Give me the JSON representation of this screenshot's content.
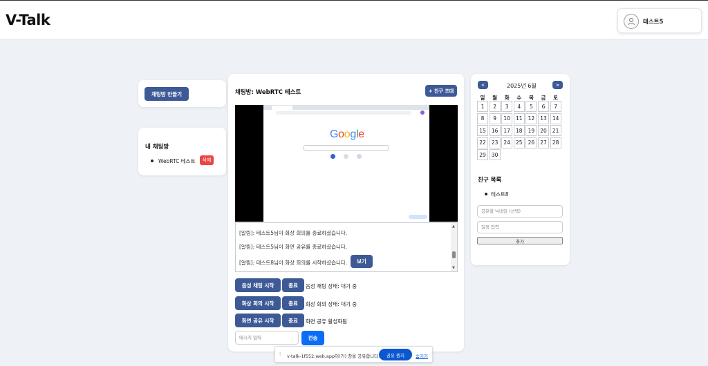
{
  "header": {
    "logo": "V-Talk",
    "user_name": "테스트5"
  },
  "sidebar": {
    "create_room_button": "채팅방 만들기",
    "my_rooms_title": "내 채팅방",
    "rooms": [
      {
        "name": "WebRTC 테스트",
        "delete_label": "삭제"
      }
    ]
  },
  "chat": {
    "title": "채팅방: WebRTC 테스트",
    "invite_button": "+ 친구 초대",
    "messages": [
      "[알림]: 테스트5님이 화상 회의를 종료하셨습니다.",
      "[알림]: 테스트5님이 화면 공유를 종료하셨습니다.",
      "[알림]: 테스트8님이 화상 회의를 시작하셨습니다."
    ],
    "view_button": "보기",
    "voice_start": "음성 채팅 시작",
    "voice_end": "종료",
    "voice_status": "음성 채팅 상태: 대기 중",
    "video_start": "화상 회의 시작",
    "video_end": "종료",
    "video_status": "화상 회의 상태: 대기 중",
    "screen_start": "화면 공유 시작",
    "screen_end": "종료",
    "screen_status": "화면 공유 활성화됨",
    "message_placeholder": "메시지 입력",
    "send_button": "전송"
  },
  "video": {
    "brand": "Google"
  },
  "calendar": {
    "prev": "<",
    "next": ">",
    "month_label": "2025년 6월",
    "weekdays": [
      "일",
      "월",
      "화",
      "수",
      "목",
      "금",
      "토"
    ],
    "days": [
      "1",
      "2",
      "3",
      "4",
      "5",
      "6",
      "7",
      "8",
      "9",
      "10",
      "11",
      "12",
      "13",
      "14",
      "15",
      "16",
      "17",
      "18",
      "19",
      "20",
      "21",
      "22",
      "23",
      "24",
      "25",
      "26",
      "27",
      "28",
      "29",
      "30"
    ]
  },
  "friends": {
    "title": "친구 목록",
    "items": [
      "테스트8"
    ],
    "nickname_placeholder": "공유할 닉네임 (선택)",
    "schedule_placeholder": "일정 입력",
    "add_button": "추가"
  },
  "share_bar": {
    "text": "v-talk-1f552.web.app이(가) 창을 공유합니다.",
    "stop_button": "공유 중지",
    "hide_link": "숨기기"
  },
  "colors": {
    "primary": "#3d5a96",
    "danger": "#ef4444",
    "send": "#0b6cf5",
    "google_blue": "#4285F4",
    "google_red": "#EA4335",
    "google_yellow": "#FBBC05",
    "google_green": "#34A853"
  }
}
